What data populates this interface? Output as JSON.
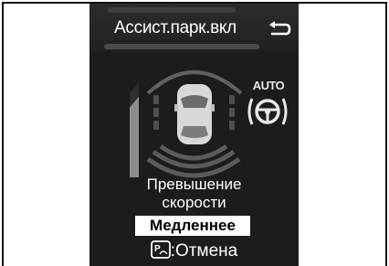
{
  "screen": {
    "title": "Ассист.парк.вкл",
    "auto_label": "AUTO",
    "message_line1": "Превышение",
    "message_line2": "скорости",
    "badge": "Медленнее",
    "cancel_label": ":Отмена"
  },
  "speed_bar_fill": 0.85,
  "colors": {
    "background": "#1b1c1c",
    "text": "#ffffff",
    "badge_bg": "#ffffff"
  },
  "icons": [
    "back-arrow-icon",
    "vehicle-icon",
    "auto-steering-wheel-icon",
    "parking-assist-icon"
  ]
}
